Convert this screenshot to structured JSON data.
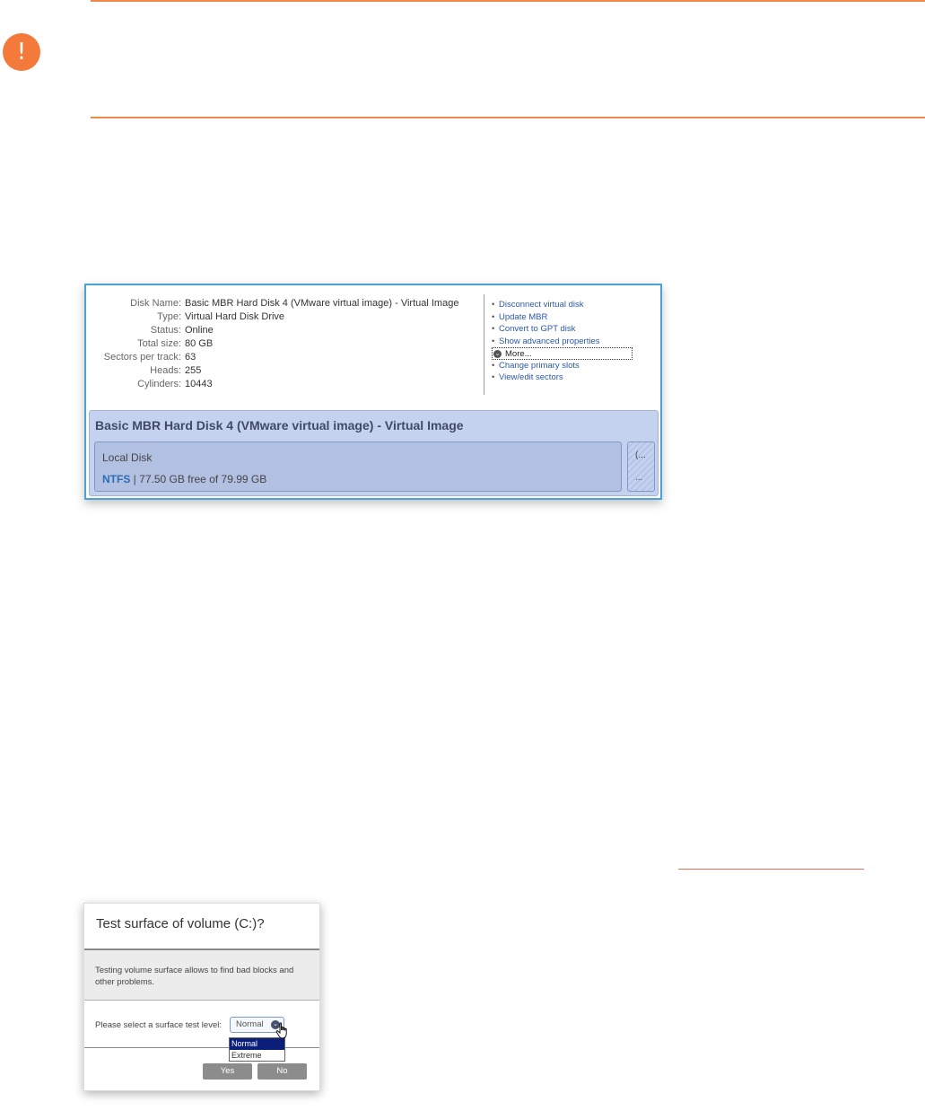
{
  "colors": {
    "accent": "#f08a4b",
    "link": "#2a5aa8",
    "panel": "#c5d2ef"
  },
  "callout": {
    "icon": "exclamation-icon",
    "glyph": "!"
  },
  "disk_properties": {
    "rows": [
      {
        "label": "Disk Name:",
        "value": "Basic MBR Hard Disk 4 (VMware virtual image) - Virtual Image"
      },
      {
        "label": "Type:",
        "value": "Virtual Hard Disk Drive"
      },
      {
        "label": "Status:",
        "value": "Online"
      },
      {
        "label": "Total size:",
        "value": "80 GB"
      },
      {
        "label": "Sectors per track:",
        "value": "63"
      },
      {
        "label": "Heads:",
        "value": "255"
      },
      {
        "label": "Cylinders:",
        "value": "10443"
      }
    ],
    "actions": {
      "disconnect": "Disconnect virtual disk",
      "update_mbr": "Update MBR",
      "convert_gpt": "Convert to GPT disk",
      "show_advanced": "Show advanced properties",
      "more": "More...",
      "change_slots": "Change primary slots",
      "view_sectors": "View/edit sectors"
    },
    "bullet": "•",
    "more_icon_glyph": "⌄",
    "disk_title": "Basic MBR Hard Disk 4 (VMware virtual image) - Virtual Image",
    "volume": {
      "name": "Local Disk",
      "fs": "NTFS",
      "separator": " | ",
      "free": "77.50 GB free of 79.99 GB"
    },
    "unallocated": {
      "top": "(...",
      "bottom": "..."
    }
  },
  "dialog": {
    "title": "Test surface of volume (C:)?",
    "description": "Testing volume surface allows to find bad blocks and other problems.",
    "select_label": "Please select a surface test level:",
    "selected_value": "Normal",
    "arrow_glyph": "⌄",
    "options": [
      "Normal",
      "Extreme"
    ],
    "yes_button": "Yes",
    "no_button": "No"
  }
}
